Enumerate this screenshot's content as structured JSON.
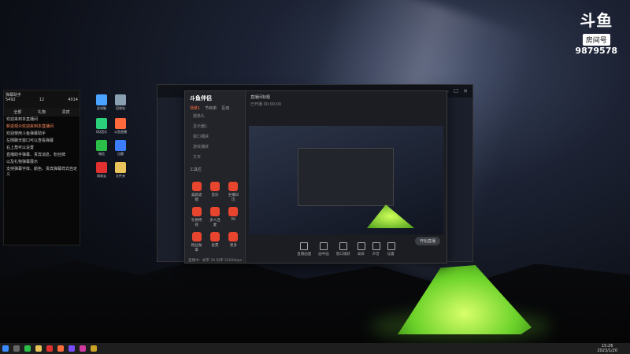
{
  "watermark": {
    "brand": "斗鱼",
    "room_tag": "房间号",
    "room_number": "9879578"
  },
  "chat": {
    "title": "弹幕助手",
    "stats": [
      "5492",
      "12",
      "4014"
    ],
    "tabs": [
      "全部",
      "礼物",
      "贵宾"
    ],
    "messages": [
      "欢迎来到本直播间",
      "新进观众欢迎来到本直播间",
      "欢迎使用斗鱼弹幕助手",
      "左侧聊天窗口可以查看弹幕",
      "右上角可以设置",
      "直播助手弹幕、贵宾消息、粉丝牌",
      "以及礼物弹幕展示",
      "支持弹幕字体、颜色、贵宾弹幕样式自定义"
    ]
  },
  "desktop_icons": [
    {
      "label": "此电脑",
      "color": "#4aa3ff"
    },
    {
      "label": "回收站",
      "color": "#8aa0b0"
    },
    {
      "label": "QQ音乐",
      "color": "#2bd17a"
    },
    {
      "label": "斗鱼直播",
      "color": "#ff6a3d"
    },
    {
      "label": "微信",
      "color": "#2bbf4a"
    },
    {
      "label": "迅雷",
      "color": "#3c7cff"
    },
    {
      "label": "网易云",
      "color": "#e23030"
    },
    {
      "label": "文件夹",
      "color": "#e8c45a"
    }
  ],
  "app": {
    "brand": "斗鱼伴侣",
    "tabs": [
      "场景1",
      "节目单",
      "互动"
    ],
    "scenes": [
      "摄像头",
      "显示器1",
      "窗口捕获",
      "游戏捕获",
      "文本"
    ],
    "header_title": "直播间标题",
    "header_sub": "已开播 00:00:00",
    "tools_title": "工具栏",
    "tools": [
      "美颜滤镜",
      "音乐",
      "主播日历",
      "礼物特效",
      "多人连麦",
      "PK",
      "粉丝勋章",
      "投票",
      "更多"
    ],
    "bottom": [
      "直播画面",
      "画中画",
      "窗口捕获",
      "录屏",
      "声音",
      "设置"
    ],
    "start_label": "开始直播",
    "status": "直播中：帧率 30  码率 2500kbps"
  },
  "clock": {
    "time": "15:26",
    "date": "2023/1/20"
  }
}
